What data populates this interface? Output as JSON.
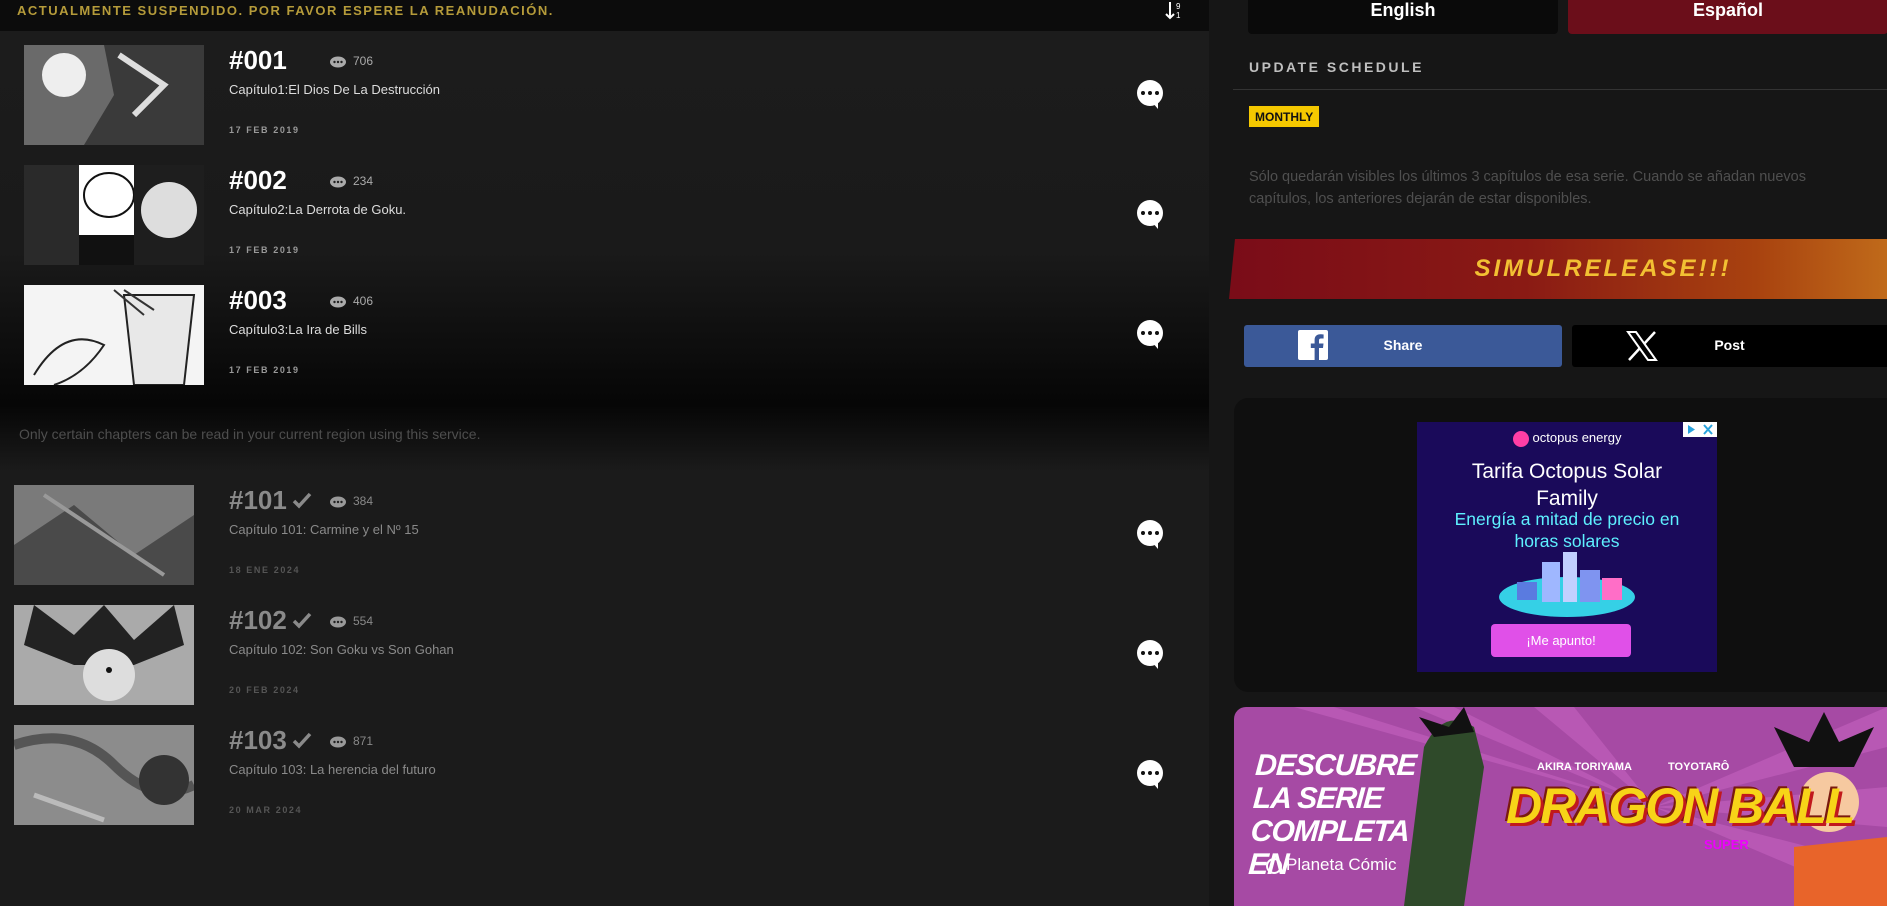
{
  "notice": "ACTUALMENTE SUSPENDIDO. POR FAVOR ESPERE LA REANUDACIÓN.",
  "chapters_available": [
    {
      "num": "#001",
      "comments": "706",
      "title": "Capítulo1:El Dios De La Destrucción",
      "date": "17 FEB 2019"
    },
    {
      "num": "#002",
      "comments": "234",
      "title": "Capítulo2:La Derrota de Goku.",
      "date": "17 FEB 2019"
    },
    {
      "num": "#003",
      "comments": "406",
      "title": "Capítulo3:La Ira de Bills",
      "date": "17 FEB 2019"
    }
  ],
  "region_note": "Only certain chapters can be read in your current region using this service.",
  "chapters_read": [
    {
      "num": "#101",
      "comments": "384",
      "title": "Capítulo 101: Carmine y el Nº 15",
      "date": "18 ENE 2024"
    },
    {
      "num": "#102",
      "comments": "554",
      "title": "Capítulo 102: Son Goku vs Son Gohan",
      "date": "20 FEB 2024"
    },
    {
      "num": "#103",
      "comments": "871",
      "title": "Capítulo 103: La herencia del futuro",
      "date": "20 MAR 2024"
    }
  ],
  "language": {
    "english": "English",
    "spanish": "Español"
  },
  "schedule": {
    "title": "UPDATE SCHEDULE",
    "badge": "MONTHLY",
    "note": "Sólo quedarán visibles los últimos 3 capítulos de esa serie. Cuando se añadan nuevos capítulos, los anteriores dejarán de estar disponibles."
  },
  "simulrelease": "SIMULRELEASE!!!",
  "share": {
    "facebook": "Share",
    "x": "Post"
  },
  "ad": {
    "brand": "octopus energy",
    "title": "Tarifa Octopus Solar Family",
    "subtitle": "Energía a mitad de precio en horas solares",
    "cta": "¡Me apunto!"
  },
  "banner": {
    "headline": "DESCUBRE LA SERIE COMPLETA EN",
    "publisher": "Planeta Cómic",
    "logo": "DRAGON BALL",
    "logo_sub": "SUPER",
    "author1": "AKIRA TORIYAMA",
    "author2": "TOYOTARÔ"
  },
  "colors": {
    "accent_gold": "#b59b3a",
    "badge": "#f5c800",
    "spanish_btn": "#6b0e1a",
    "facebook": "#3b5998"
  }
}
